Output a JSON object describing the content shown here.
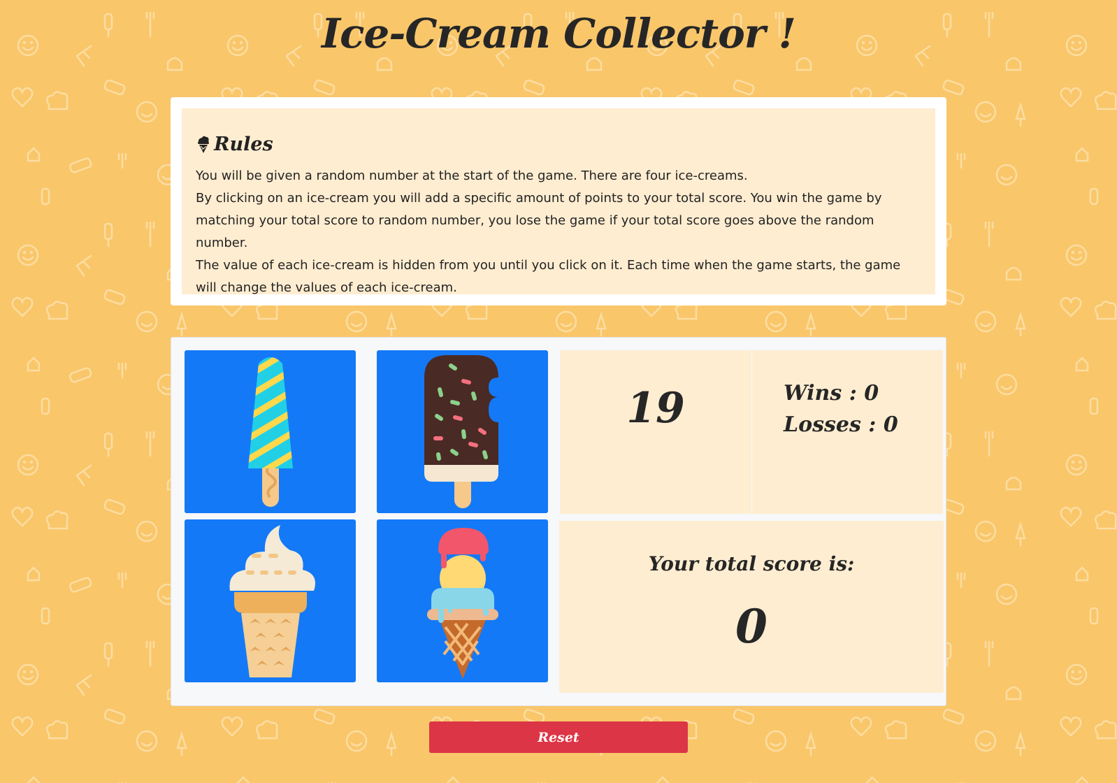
{
  "app": {
    "title": "Ice-Cream Collector !"
  },
  "rules": {
    "icon": "ice-cream-cone-icon",
    "title": "Rules",
    "paragraphs": [
      "You will be given a random number at the start of the game. There are four ice-creams.",
      "By clicking on an ice-cream you will add a specific amount of points to your total score. You win the game by matching your total score to random number, you lose the game if your total score goes above the random number.",
      "The value of each ice-cream is hidden from you until you click on it. Each time when the game starts, the game will change the values of each ice-cream."
    ]
  },
  "game": {
    "tiles": [
      {
        "icon": "striped-popsicle-icon"
      },
      {
        "icon": "chocolate-sprinkle-popsicle-icon"
      },
      {
        "icon": "soft-serve-cone-icon"
      },
      {
        "icon": "scoop-cone-icon"
      }
    ],
    "target_number": "19",
    "wins_label": "Wins : 0",
    "losses_label": "Losses : 0",
    "score_label": "Your total score is:",
    "score_value": "0"
  },
  "reset": {
    "label": "Reset"
  },
  "colors": {
    "background": "#f9c66a",
    "panel": "#ffedd1",
    "tile": "#1479f7",
    "reset": "#dc3545",
    "text": "#262626"
  }
}
